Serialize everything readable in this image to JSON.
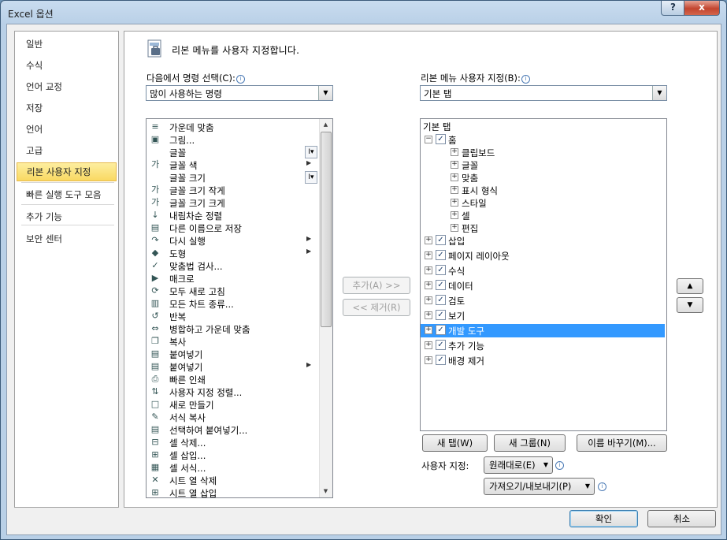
{
  "window": {
    "title": "Excel 옵션",
    "help": "?",
    "close": "x"
  },
  "nav": {
    "items": [
      "일반",
      "수식",
      "언어 교정",
      "저장",
      "언어",
      "고급",
      "리본 사용자 지정",
      "빠른 실행 도구 모음",
      "추가 기능",
      "보안 센터"
    ],
    "selected_index": 6
  },
  "header": {
    "text": "리본 메뉴를 사용자 지정합니다."
  },
  "left": {
    "label": "다음에서 명령 선택(C):",
    "combo_value": "많이 사용하는 명령",
    "commands": [
      {
        "icon": "center-align-icon",
        "glyph": "≡",
        "label": "가운데 맞춤"
      },
      {
        "icon": "picture-icon",
        "glyph": "▣",
        "label": "그림..."
      },
      {
        "icon": "font-icon",
        "glyph": "",
        "label": "글꼴",
        "ctl": "I▾"
      },
      {
        "icon": "font-color-icon",
        "glyph": "가",
        "label": "글꼴 색",
        "sub": "▶"
      },
      {
        "icon": "font-size-icon",
        "glyph": "",
        "label": "글꼴 크기",
        "ctl": "I▾"
      },
      {
        "icon": "shrink-font-icon",
        "glyph": "가",
        "label": "글꼴 크기 작게"
      },
      {
        "icon": "grow-font-icon",
        "glyph": "가",
        "label": "글꼴 크기 크게"
      },
      {
        "icon": "sort-desc-icon",
        "glyph": "↓",
        "label": "내림차순 정렬"
      },
      {
        "icon": "save-as-icon",
        "glyph": "▤",
        "label": "다른 이름으로 저장"
      },
      {
        "icon": "redo-icon",
        "glyph": "↷",
        "label": "다시 실행",
        "sub": "▶"
      },
      {
        "icon": "shapes-icon",
        "glyph": "◆",
        "label": "도형",
        "sub": "▶"
      },
      {
        "icon": "spelling-icon",
        "glyph": "✓",
        "label": "맞춤법 검사..."
      },
      {
        "icon": "macro-icon",
        "glyph": "▶",
        "label": "매크로"
      },
      {
        "icon": "refresh-all-icon",
        "glyph": "⟳",
        "label": "모두 새로 고침"
      },
      {
        "icon": "chart-types-icon",
        "glyph": "▥",
        "label": "모든 차트 종류..."
      },
      {
        "icon": "repeat-icon",
        "glyph": "↺",
        "label": "반복"
      },
      {
        "icon": "merge-center-icon",
        "glyph": "⇔",
        "label": "병합하고 가운데 맞춤"
      },
      {
        "icon": "copy-icon",
        "glyph": "❐",
        "label": "복사"
      },
      {
        "icon": "paste-icon",
        "glyph": "▤",
        "label": "붙여넣기"
      },
      {
        "icon": "paste-menu-icon",
        "glyph": "▤",
        "label": "붙여넣기",
        "sub": "▶"
      },
      {
        "icon": "quick-print-icon",
        "glyph": "⎙",
        "label": "빠른 인쇄"
      },
      {
        "icon": "custom-sort-icon",
        "glyph": "⇅",
        "label": "사용자 지정 정렬..."
      },
      {
        "icon": "new-file-icon",
        "glyph": "□",
        "label": "새로 만들기"
      },
      {
        "icon": "format-painter-icon",
        "glyph": "✎",
        "label": "서식 복사"
      },
      {
        "icon": "paste-special-icon",
        "glyph": "▤",
        "label": "선택하여 붙여넣기..."
      },
      {
        "icon": "delete-cells-icon",
        "glyph": "⊟",
        "label": "셀 삭제..."
      },
      {
        "icon": "insert-cells-icon",
        "glyph": "⊞",
        "label": "셀 삽입..."
      },
      {
        "icon": "format-cells-icon",
        "glyph": "▦",
        "label": "셀 서식..."
      },
      {
        "icon": "delete-sheet-columns-icon",
        "glyph": "✕",
        "label": "시트 열 삭제"
      },
      {
        "icon": "insert-sheet-columns-icon",
        "glyph": "⊞",
        "label": "시트 열 삽입"
      }
    ]
  },
  "middle": {
    "add": "추가(A) >>",
    "remove": "<< 제거(R)"
  },
  "right": {
    "label": "리본 메뉴 사용자 지정(B):",
    "combo_value": "기본 탭",
    "tree_header": "기본 탭",
    "home": "홈",
    "home_groups": [
      "클립보드",
      "글꼴",
      "맞춤",
      "표시 형식",
      "스타일",
      "셀",
      "편집"
    ],
    "tabs": [
      "삽입",
      "페이지 레이아웃",
      "수식",
      "데이터",
      "검토",
      "보기",
      "개발 도구",
      "추가 기능",
      "배경 제거"
    ],
    "selected_tab": "개발 도구",
    "new_tab": "새 탭(W)",
    "new_group": "새 그룹(N)",
    "rename": "이름 바꾸기(M)...",
    "customize_label": "사용자 지정:",
    "reset_value": "원래대로(E)",
    "import_export": "가져오기/내보내기(P)"
  },
  "footer": {
    "ok": "확인",
    "cancel": "취소"
  }
}
